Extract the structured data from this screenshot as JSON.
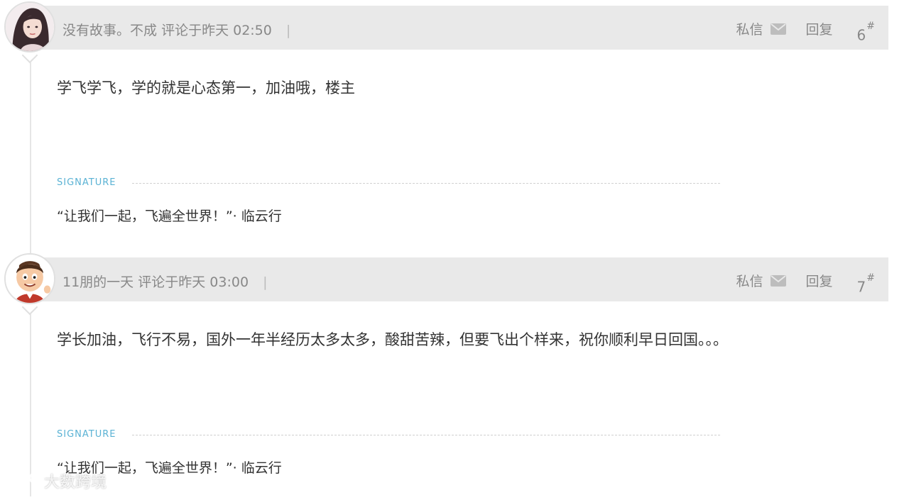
{
  "posts": [
    {
      "author": "没有故事。不成",
      "time_text": "评论于昨天 02:50",
      "separator": "|",
      "pm_label": "私信",
      "reply_label": "回复",
      "floor_num": "6",
      "floor_mark": "#",
      "content": "学飞学飞，学的就是心态第一，加油哦，楼主",
      "signature_label": "SIGNATURE",
      "signature_text": "“让我们一起，飞遍全世界！”· 临云行",
      "avatar_icon": "female-user-avatar"
    },
    {
      "author": "11朋的一天",
      "time_text": "评论于昨天 03:00",
      "separator": "|",
      "pm_label": "私信",
      "reply_label": "回复",
      "floor_num": "7",
      "floor_mark": "#",
      "content": "学长加油，飞行不易，国外一年半经历太多太多，酸甜苦辣，但要飞出个样来，祝你顺利早日回国。。。",
      "signature_label": "SIGNATURE",
      "signature_text": "“让我们一起，飞遍全世界！”· 临云行",
      "avatar_icon": "cartoon-user-avatar"
    }
  ],
  "watermark": {
    "text": "大数跨境",
    "icon": "brand-logo-icon"
  },
  "colors": {
    "header_bg": "#e9e9e9",
    "signature_accent": "#5ab2d4",
    "meta_text": "#888888"
  }
}
